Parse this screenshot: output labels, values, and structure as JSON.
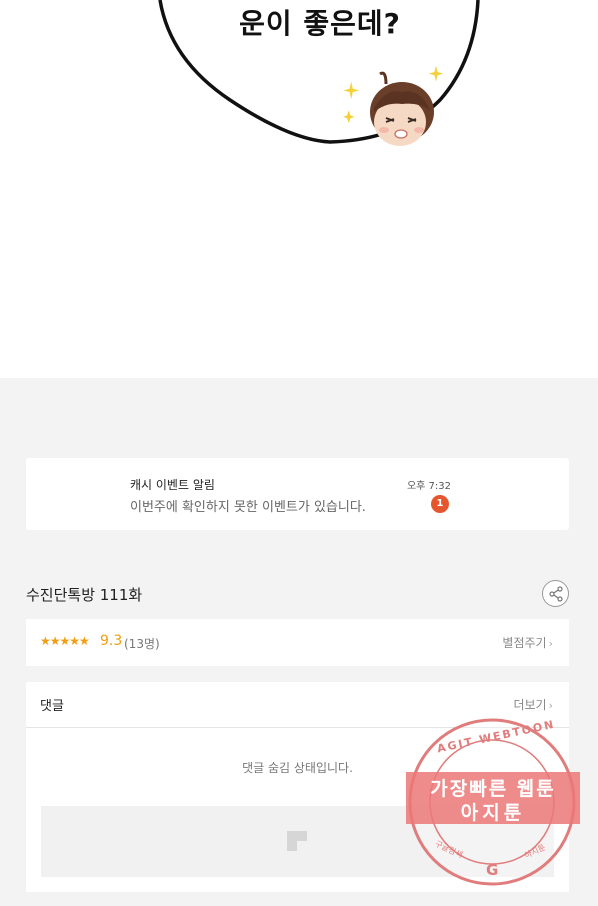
{
  "comic": {
    "bubble_text": "운이 좋은데?"
  },
  "notice": {
    "title": "캐시 이벤트 알림",
    "body": "이번주에 확인하지 못한 이벤트가 있습니다.",
    "time": "오후 7:32",
    "badge_count": "1"
  },
  "episode": {
    "title": "수진단톡방 111화"
  },
  "rating": {
    "stars": "★★★★★",
    "score": "9.3",
    "count": "(13명)",
    "rate_label": "별점주기"
  },
  "comments": {
    "label": "댓글",
    "more_label": "더보기",
    "hidden_message": "댓글 숨김 상태입니다."
  },
  "watermark": {
    "arc_text": "AGIT WEBTOON",
    "line1": "가장빠른 웹툰",
    "line2": "아지툰",
    "bottom_left": "구글검색",
    "bottom_right": "아지툰",
    "center": "G"
  },
  "colors": {
    "accent_orange": "#f29d12",
    "badge_red": "#e4572e",
    "stamp_pink": "#e07c7c",
    "section_gray": "#f3f3f3"
  }
}
